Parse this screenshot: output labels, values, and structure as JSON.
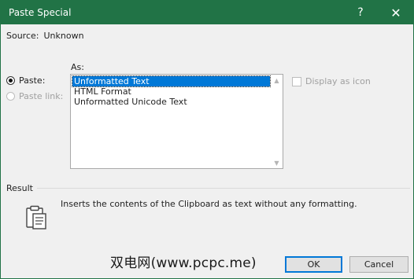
{
  "titlebar": {
    "title": "Paste Special",
    "help": "?",
    "close": "✕"
  },
  "source": {
    "label": "Source:",
    "value": "Unknown"
  },
  "as_label": "As:",
  "paste_options": [
    {
      "label": "Paste:",
      "checked": true,
      "enabled": true
    },
    {
      "label": "Paste link:",
      "checked": false,
      "enabled": false
    }
  ],
  "formats": [
    {
      "label": "Unformatted Text",
      "selected": true
    },
    {
      "label": "HTML Format",
      "selected": false
    },
    {
      "label": "Unformatted Unicode Text",
      "selected": false
    }
  ],
  "display_as_icon": {
    "label": "Display as icon",
    "checked": false,
    "enabled": false
  },
  "result": {
    "label": "Result",
    "text": "Inserts the contents of the Clipboard as text without any formatting."
  },
  "watermark": "双电网(www.pcpc.me)",
  "buttons": {
    "ok": "OK",
    "cancel": "Cancel"
  },
  "colors": {
    "titlebar": "#217346",
    "selection": "#0078d7"
  }
}
